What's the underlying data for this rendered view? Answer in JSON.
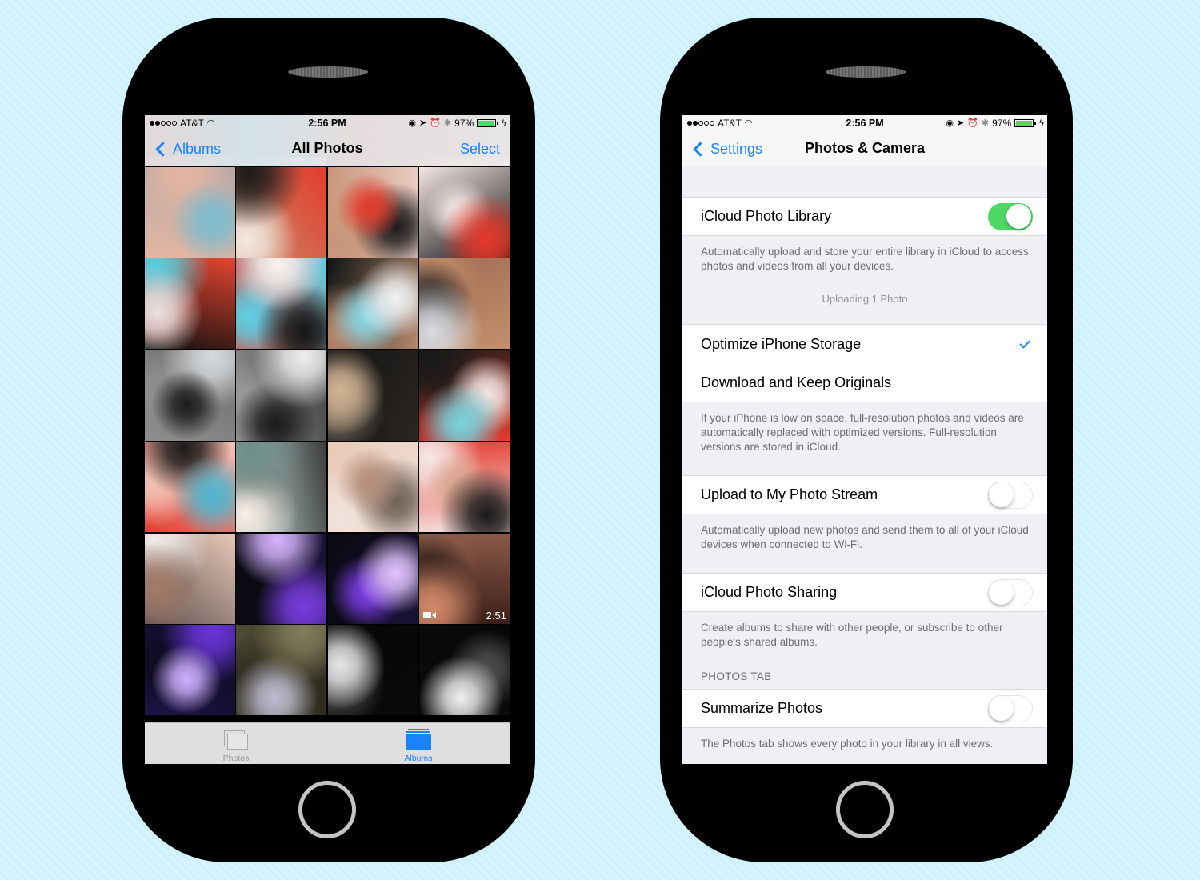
{
  "status_bar": {
    "carrier": "AT&T",
    "signal_bars_filled": 2,
    "signal_bars_total": 5,
    "time": "2:56 PM",
    "battery_percent_label": "97%",
    "battery_level": 0.97,
    "icons": [
      "wifi-icon",
      "orientation-lock-icon",
      "location-icon",
      "alarm-icon",
      "bluetooth-icon",
      "battery-icon",
      "charging-icon"
    ]
  },
  "photos_screen": {
    "nav": {
      "back_label": "Albums",
      "title": "All Photos",
      "right_label": "Select"
    },
    "grid": {
      "columns": 4,
      "photos": [
        {
          "palette": [
            "#2a2a2a",
            "#6b6b6b"
          ],
          "partial": true
        },
        {
          "palette": [
            "#1e1e1e",
            "#8a8a8a"
          ],
          "partial": true
        },
        {
          "palette": [
            "#222",
            "#777"
          ],
          "partial": true
        },
        {
          "palette": [
            "#3a2520",
            "#b05040"
          ],
          "partial": true
        },
        {
          "palette": [
            "#b9a8a8",
            "#7bbcd0",
            "#e3b6a0"
          ]
        },
        {
          "palette": [
            "#e53b2c",
            "#1b1b1b",
            "#f4e6e0",
            "#c48f6c"
          ]
        },
        {
          "palette": [
            "#f1d5d0",
            "#e23a2a",
            "#1a1a1a",
            "#c79579"
          ]
        },
        {
          "palette": [
            "#141414",
            "#e6382a",
            "#f3e5e3"
          ]
        },
        {
          "palette": [
            "#101010",
            "#e8e0e0",
            "#57d0e0",
            "#e4442f"
          ]
        },
        {
          "palette": [
            "#e93a2d",
            "#fbf1ee",
            "#151515",
            "#5ccfe6"
          ]
        },
        {
          "palette": [
            "#0f1414",
            "#f0f3f5",
            "#8ad8e8",
            "#b8896d"
          ]
        },
        {
          "palette": [
            "#9e6c55",
            "#d8dbe0",
            "#1d1d1d",
            "#c48f6c"
          ]
        },
        {
          "palette": [
            "#6b6b6b",
            "#1c1c1c",
            "#d7dadd",
            "#8e8e8e"
          ]
        },
        {
          "palette": [
            "#3e3e3e",
            "#f0f0f0",
            "#1a1a1a",
            "#9a9a9a"
          ]
        },
        {
          "palette": [
            "#2a2622",
            "#d0b290",
            "#7b6e61",
            "#141414"
          ]
        },
        {
          "palette": [
            "#e53b2c",
            "#76d5e1",
            "#f5e8e5",
            "#1a1a1a"
          ]
        },
        {
          "palette": [
            "#e23e2f",
            "#4db7d1",
            "#1b1b1b",
            "#f2c5b8"
          ]
        },
        {
          "palette": [
            "#cfe8e7",
            "#6d8d86",
            "#f8f1ea",
            "#3c3c3c"
          ]
        },
        {
          "palette": [
            "#e9c9b5",
            "#b58d7a",
            "#6e5f57",
            "#f0e1da"
          ]
        },
        {
          "palette": [
            "#e3392c",
            "#191919",
            "#d9a58c",
            "#f5e9e7"
          ]
        },
        {
          "palette": [
            "#e7c8b6",
            "#a27a68",
            "#f1ece9",
            "#5d5050"
          ]
        },
        {
          "palette": [
            "#1a1237",
            "#d6b4ff",
            "#7a3ce0",
            "#0a0a12"
          ]
        },
        {
          "palette": [
            "#1a1237",
            "#e2c4ff",
            "#7d3ee6",
            "#0a0a12"
          ]
        },
        {
          "palette": [
            "#3a1e18",
            "#d58a6a",
            "#1d1210",
            "#8a5a48"
          ],
          "video_duration": "2:51"
        },
        {
          "palette": [
            "#1c1547",
            "#cfb0ff",
            "#6a35d8",
            "#0e0b22"
          ]
        },
        {
          "palette": [
            "#4d4c33",
            "#817c5b",
            "#c0bcd2",
            "#2e2b1f"
          ]
        },
        {
          "palette": [
            "#060606",
            "#e6e6e6",
            "#4a4a4a",
            "#0a0a0a"
          ]
        },
        {
          "palette": [
            "#070707",
            "#f0f0f0",
            "#505050",
            "#0a0a0a"
          ]
        }
      ]
    },
    "tab_bar": {
      "tabs": [
        {
          "label": "Photos",
          "icon": "photos-stack-icon",
          "selected": false
        },
        {
          "label": "Albums",
          "icon": "albums-icon",
          "selected": true
        }
      ]
    }
  },
  "settings_screen": {
    "nav": {
      "back_label": "Settings",
      "title": "Photos & Camera"
    },
    "icloud_photo_library": {
      "label": "iCloud Photo Library",
      "enabled": true,
      "footer": "Automatically upload and store your entire library in iCloud to access photos and videos from all your devices.",
      "status": "Uploading 1 Photo"
    },
    "storage_options": {
      "options": [
        {
          "label": "Optimize iPhone Storage",
          "selected": true
        },
        {
          "label": "Download and Keep Originals",
          "selected": false
        }
      ],
      "footer": "If your iPhone is low on space, full-resolution photos and videos are automatically replaced with optimized versions. Full-resolution versions are stored in iCloud."
    },
    "photo_stream": {
      "label": "Upload to My Photo Stream",
      "enabled": false,
      "footer": "Automatically upload new photos and send them to all of your iCloud devices when connected to Wi-Fi."
    },
    "photo_sharing": {
      "label": "iCloud Photo Sharing",
      "enabled": false,
      "footer": "Create albums to share with other people, or subscribe to other people's shared albums."
    },
    "photos_tab": {
      "header": "PHOTOS TAB",
      "summarize": {
        "label": "Summarize Photos",
        "enabled": false
      },
      "footer": "The Photos tab shows every photo in your library in all views."
    }
  },
  "colors": {
    "accent": "#1a82fb",
    "toggle_on": "#4cd964",
    "background": "#d4f3fd",
    "grouped_background": "#efeff4"
  }
}
